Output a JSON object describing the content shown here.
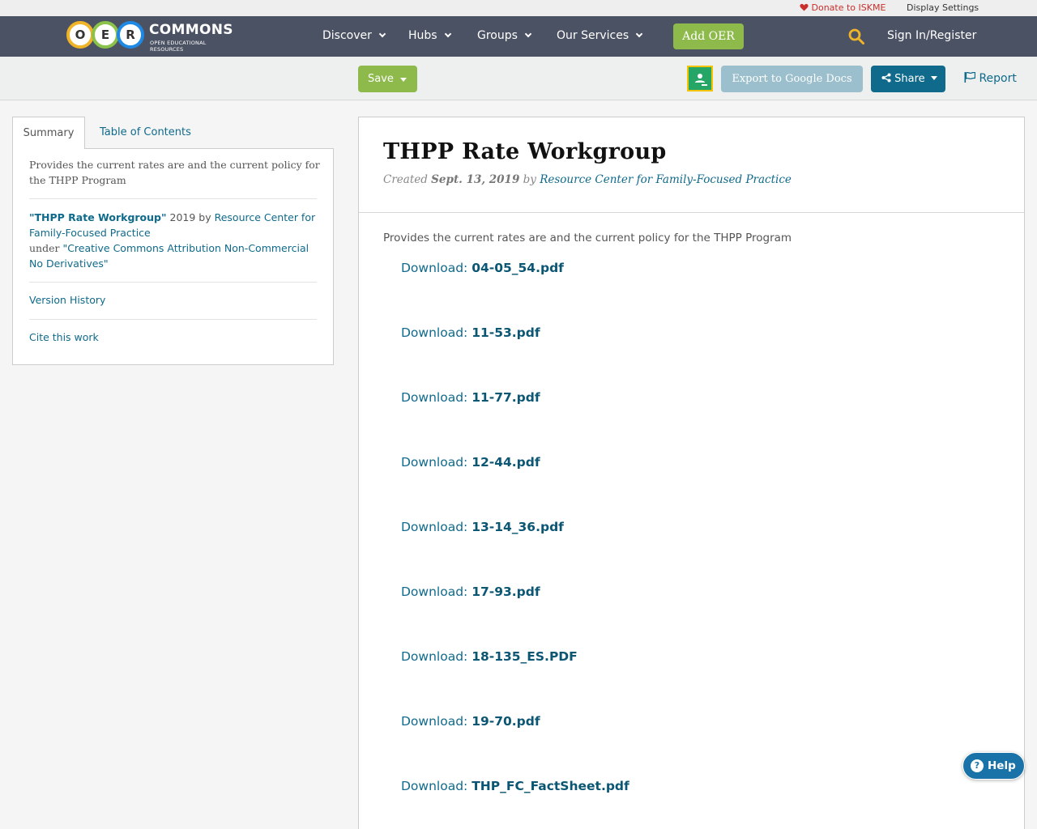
{
  "utility_bar": {
    "donate": "Donate to ISKME",
    "display_settings": "Display Settings"
  },
  "nav": {
    "logo_letters": [
      "O",
      "E",
      "R"
    ],
    "logo_brand": "COMMONS",
    "logo_tagline": "OPEN EDUCATIONAL RESOURCES",
    "items": [
      "Discover",
      "Hubs",
      "Groups",
      "Our Services"
    ],
    "add_oer": "Add OER",
    "sign_in": "Sign In/Register"
  },
  "toolbar": {
    "save": "Save",
    "export": "Export to Google Docs",
    "share": "Share",
    "report": "Report"
  },
  "sidebar": {
    "tabs": [
      "Summary",
      "Table of Contents"
    ],
    "description": "Provides the current rates are and the current policy for the THPP Program",
    "attribution": {
      "title": "\"THPP Rate Workgroup\"",
      "year_by": " 2019 by ",
      "author": "Resource Center for Family-Focused Practice",
      "under": "under ",
      "license": "\"Creative Commons Attribution Non-Commercial No Derivatives\""
    },
    "version_history": "Version History",
    "cite": "Cite this work"
  },
  "content": {
    "title": "THPP Rate Workgroup",
    "created_label": "Created ",
    "created_date": "Sept. 13, 2019",
    "by_label": " by ",
    "author": "Resource Center for Family-Focused Practice",
    "description": "Provides the current rates are and the current policy for the THPP Program",
    "download_label": "Download: ",
    "downloads": [
      "04-05_54.pdf",
      "11-53.pdf",
      "11-77.pdf",
      "12-44.pdf",
      "13-14_36.pdf",
      "17-93.pdf",
      "18-135_ES.PDF",
      "19-70.pdf",
      "THP_FC_FactSheet.pdf"
    ]
  },
  "help": {
    "label": "Help",
    "icon": "?"
  },
  "colors": {
    "nav_bg": "#4b5263",
    "green": "#8dba4b",
    "link": "#0f6a8b",
    "share_bg": "#0f6a8b",
    "export_bg": "#9bbfcc"
  }
}
